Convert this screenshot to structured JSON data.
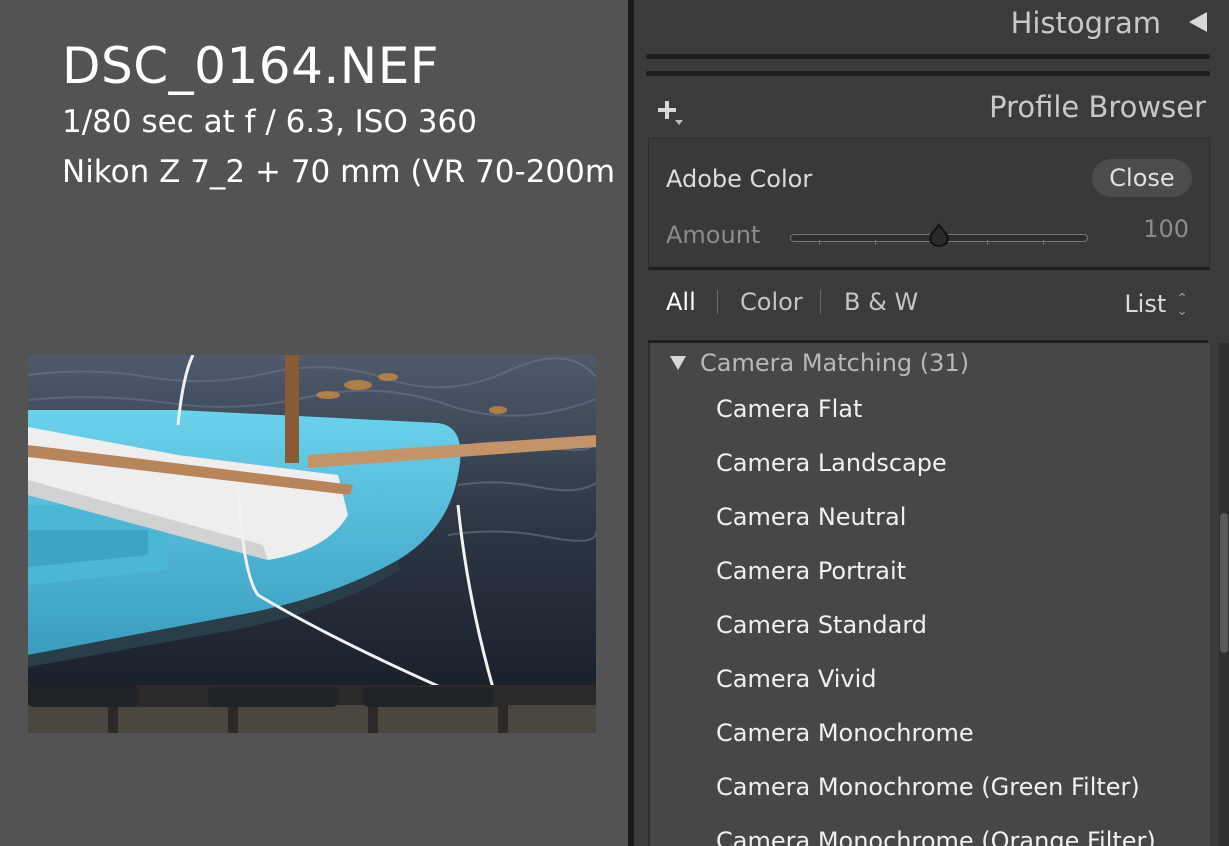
{
  "photo_info": {
    "file_name": "DSC_0164.NEF",
    "exposure": "1/80 sec at f / 6.3, ISO 360",
    "camera_lens": "Nikon Z 7_2 + 70 mm (VR 70-200m"
  },
  "histogram": {
    "title": "Histogram",
    "collapse_icon": "triangle-left-icon"
  },
  "profile_browser": {
    "title": "Profile Browser",
    "add_icon": "plus-dropdown-icon",
    "selected_profile": "Adobe Color",
    "close_label": "Close",
    "amount_label": "Amount",
    "amount_value": "100",
    "amount_fraction": 0.5,
    "filters": [
      "All",
      "Color",
      "B & W"
    ],
    "active_filter": "All",
    "view_label": "List",
    "group": {
      "name": "Camera Matching (31)",
      "expanded": true,
      "items": [
        "Camera Flat",
        "Camera Landscape",
        "Camera Neutral",
        "Camera Portrait",
        "Camera Standard",
        "Camera Vivid",
        "Camera Monochrome",
        "Camera Monochrome (Green Filter)",
        "Camera Monochrome (Orange Filter)"
      ]
    }
  },
  "colors": {
    "background": "#535353",
    "panel": "#3b3b3b",
    "list_bg": "#474747",
    "boat_blue": "#5bbfdc"
  }
}
